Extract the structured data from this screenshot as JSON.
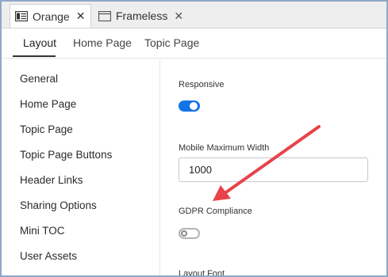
{
  "doc_tabs": [
    {
      "label": "Orange",
      "close": "✕",
      "active": true
    },
    {
      "label": "Frameless",
      "close": "✕",
      "active": false
    }
  ],
  "sub_tabs": [
    "Layout",
    "Home Page",
    "Topic Page"
  ],
  "sidebar": {
    "items": [
      "General",
      "Home Page",
      "Topic Page",
      "Topic Page Buttons",
      "Header Links",
      "Sharing Options",
      "Mini TOC",
      "User Assets"
    ]
  },
  "main": {
    "responsive_label": "Responsive",
    "responsive_on": true,
    "mobile_width_label": "Mobile Maximum Width",
    "mobile_width_value": "1000",
    "gdpr_label": "GDPR Compliance",
    "gdpr_on": false,
    "layout_font_label": "Layout Font"
  },
  "colors": {
    "accent": "#1473e6",
    "annotation_arrow": "#e8434a",
    "frame_border": "#8fa8c8"
  }
}
